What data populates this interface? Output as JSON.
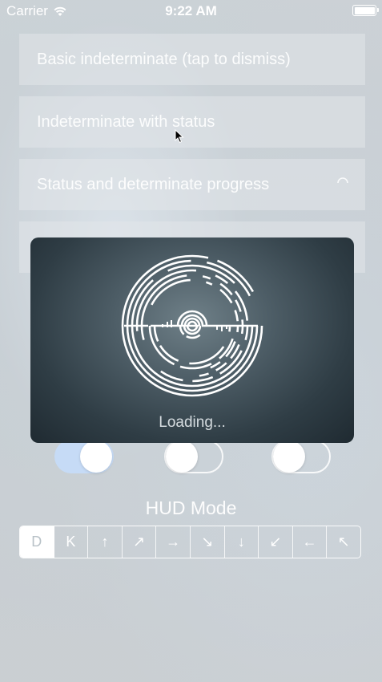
{
  "status_bar": {
    "carrier": "Carrier",
    "time": "9:22 AM"
  },
  "rows": [
    {
      "label": "Basic indeterminate (tap to dismiss)"
    },
    {
      "label": "Indeterminate with status"
    },
    {
      "label": "Status and determinate progress"
    },
    {
      "label": ""
    }
  ],
  "hud": {
    "label": "Loading..."
  },
  "switches": [
    {
      "state": "on"
    },
    {
      "state": "off"
    },
    {
      "state": "off"
    }
  ],
  "hud_mode": {
    "title": "HUD Mode",
    "segments": [
      "D",
      "K",
      "↑",
      "↗",
      "→",
      "↘",
      "↓",
      "↙",
      "←",
      "↖"
    ],
    "selected_index": 0
  },
  "colors": {
    "switch_on": "#c6dbf6",
    "hud_text": "#e6ebee"
  }
}
